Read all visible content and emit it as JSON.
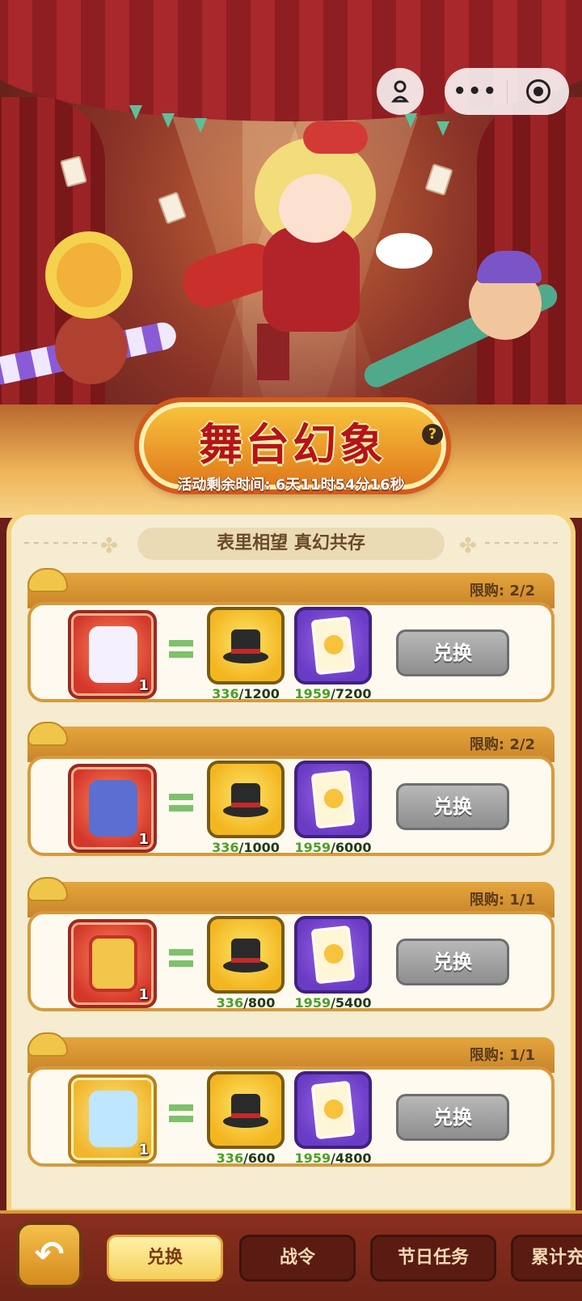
{
  "top_bar": {
    "avatar_icon": "person-pin-icon",
    "more_label": "•••",
    "record_icon": "record-icon"
  },
  "event": {
    "title": "舞台幻象",
    "timer": "活动剩余时间: 6天11时54分16秒",
    "subtitle": "表里相望 真幻共存",
    "help_label": "?"
  },
  "exchange_items": [
    {
      "limit": "限购: 2/2",
      "reward_icon": "princess-character-icon",
      "reward_count": "1",
      "hat_have": "336",
      "hat_need": "1200",
      "card_have": "1959",
      "card_need": "7200",
      "button": "兑换"
    },
    {
      "limit": "限购: 2/2",
      "reward_icon": "crystal-weapon-icon",
      "reward_count": "1",
      "hat_have": "336",
      "hat_need": "1000",
      "card_have": "1959",
      "card_need": "6000",
      "button": "兑换"
    },
    {
      "limit": "限购: 1/1",
      "reward_icon": "treasure-chest-icon",
      "reward_count": "1",
      "hat_have": "336",
      "hat_need": "800",
      "card_have": "1959",
      "card_need": "5400",
      "button": "兑换"
    },
    {
      "limit": "限购: 1/1",
      "reward_icon": "ice-crystal-card-icon",
      "reward_count": "1",
      "hat_have": "336",
      "hat_need": "600",
      "card_have": "1959",
      "card_need": "4800",
      "button": "兑换"
    }
  ],
  "nav": {
    "back_icon": "back-arrow-icon",
    "tabs": [
      "兑换",
      "战令",
      "节日任务",
      "累计充"
    ],
    "active_tab": "兑换"
  },
  "colors": {
    "primary_red": "#b5141a",
    "panel_bg": "#f5ecd2",
    "gold": "#f5d37a",
    "have_green": "#4aa02a",
    "button_gray": "#8e8e8e"
  }
}
